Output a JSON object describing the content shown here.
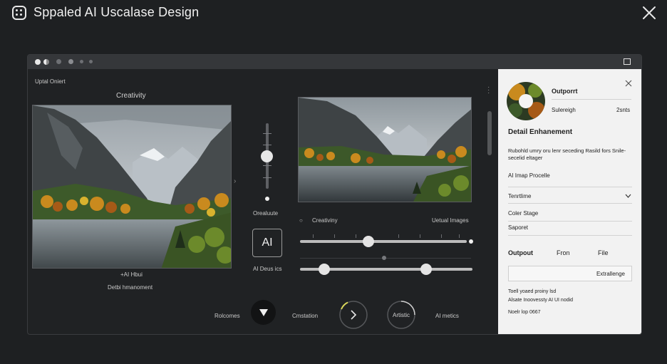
{
  "app": {
    "title": "Sppaled AI Uscalase Design"
  },
  "left": {
    "upload_label": "Uptal Oniert",
    "creativity_label": "Creativity",
    "caption1": "+AI Hbui",
    "caption2": "Detbi hmanoment"
  },
  "middle": {
    "slider_label": "Orealuute",
    "ai_button": "AI",
    "ai_caption": "AI Deus ics"
  },
  "right": {
    "creativity_label": "Creativiny",
    "images_label": "Uetual Images"
  },
  "bottom": {
    "rolcomes": "Rolcomes",
    "cmstation": "Cmstation",
    "artistic": "Artistic",
    "ai_metics": "AI metics"
  },
  "panel": {
    "title": "Outporrt",
    "sub_left": "Sulereigh",
    "sub_right": "2snts",
    "section_title": "Detail Enhanement",
    "desc": "Rubohld umry oru lenr seceding Rasild fors Snile-",
    "desc2": "secelid eltager",
    "item1": "AI Imap Procelle",
    "dropdown": "Tenrtlime",
    "item2": "Coler Stage",
    "item3": "Saporet",
    "output_label": "Outpout",
    "col2": "Fron",
    "col3": "File",
    "ext_button": "Extrallenge",
    "note1": "Toell yoaed proiny lsd",
    "note2": "Alsate Inoovessty AI UI nodid",
    "note3": "Noelr lop 0667"
  },
  "colors": {
    "background": "#1e2022",
    "window": "#202224",
    "panel": "#f2f2f2",
    "knob": "#e4e4e4"
  }
}
